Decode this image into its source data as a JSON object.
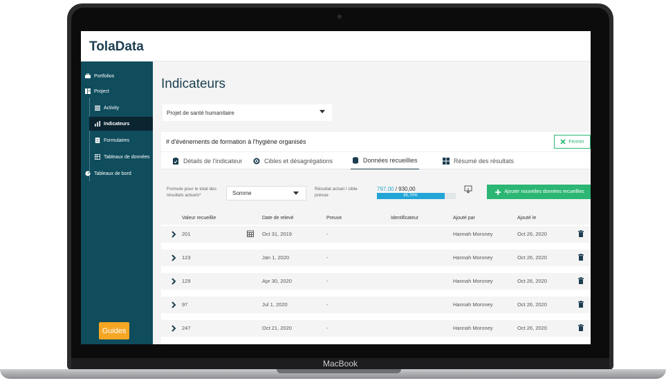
{
  "device": {
    "label": "MacBook"
  },
  "app": {
    "logo": "TolaData"
  },
  "sidebar": {
    "items": [
      {
        "label": "Portfolios",
        "icon": "briefcase-icon"
      },
      {
        "label": "Project",
        "icon": "project-icon"
      },
      {
        "label": "Activity",
        "icon": "activity-icon"
      },
      {
        "label": "Indicateurs",
        "icon": "bar-chart-icon",
        "active": true
      },
      {
        "label": "Formulaires",
        "icon": "document-icon"
      },
      {
        "label": "Tableaux de données",
        "icon": "table-icon"
      },
      {
        "label": "Tableaux de bord",
        "icon": "dashboard-icon"
      }
    ],
    "guides_label": "Guides"
  },
  "main": {
    "title": "Indicateurs",
    "project_select": "Projet de santé humanitaire"
  },
  "indicator": {
    "title": "# d'événements de formation à l'hygiène organisés",
    "close_label": "Fermer",
    "tabs": [
      {
        "label": "Détails de l'indicateur",
        "icon": "clipboard-icon"
      },
      {
        "label": "Cibles et désagrégations",
        "icon": "target-icon"
      },
      {
        "label": "Données recueillies",
        "icon": "database-icon",
        "active": true
      },
      {
        "label": "Résumé des résultats",
        "icon": "grid-icon"
      }
    ],
    "formula_label": "Formule pour le total des résultats actuels*",
    "formula_value": "Somme",
    "result_label": "Résultat actuel / cible prévue",
    "result_actual": "797,00",
    "result_sep": " / ",
    "result_target": "930,00",
    "progress_text": "85,70%",
    "progress_fraction": 0.857,
    "add_label": "Ajouter nouvelles données recueillies"
  },
  "table": {
    "headers": [
      "Valeur recueillie",
      "Date de relevé",
      "Preuve",
      "Identificateur",
      "Ajouté par",
      "Ajouté le"
    ],
    "rows": [
      {
        "value": "201",
        "date": "Oct 31, 2019",
        "proof": "-",
        "id": "",
        "by": "Hannah Moroney",
        "added": "Oct 26, 2020"
      },
      {
        "value": "123",
        "date": "Jan 1, 2020",
        "proof": "-",
        "id": "",
        "by": "Hannah Moroney",
        "added": "Oct 26, 2020"
      },
      {
        "value": "129",
        "date": "Apr 30, 2020",
        "proof": "-",
        "id": "",
        "by": "Hannah Moroney",
        "added": "Oct 26, 2020"
      },
      {
        "value": "97",
        "date": "Jul 1, 2020",
        "proof": "-",
        "id": "",
        "by": "Hannah Moroney",
        "added": "Oct 26, 2020"
      },
      {
        "value": "247",
        "date": "Oct 21, 2020",
        "proof": "-",
        "id": "",
        "by": "Hannah Moroney",
        "added": "Oct 26, 2020"
      }
    ]
  },
  "colors": {
    "sidebar": "#0f4c5c",
    "accent": "#2bb673",
    "progress": "#21a5d6",
    "guides": "#f5a623"
  }
}
